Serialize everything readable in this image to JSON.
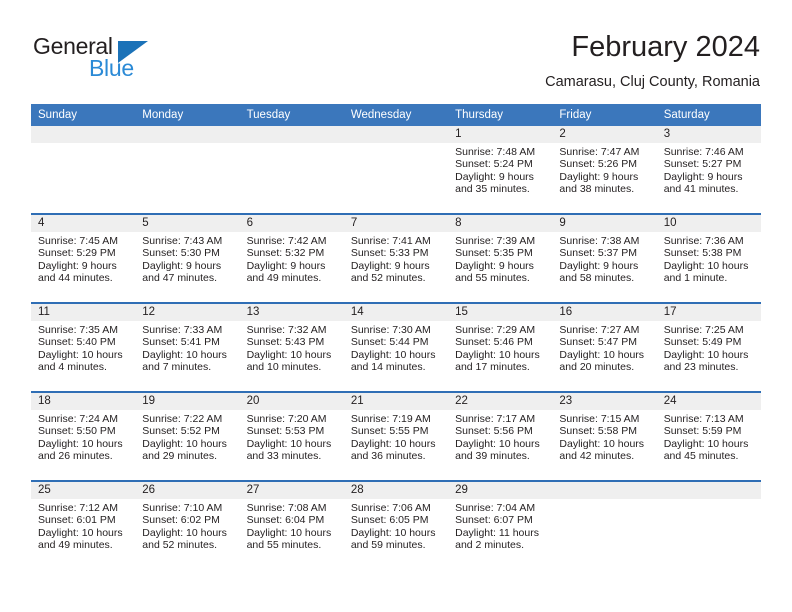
{
  "brand": {
    "line1": "General",
    "line2": "Blue",
    "triangle_color": "#1b72b8",
    "blue_text_color": "#2b8ad6"
  },
  "header": {
    "title": "February 2024",
    "location": "Camarasu, Cluj County, Romania"
  },
  "theme": {
    "header_blue": "#3b77bc",
    "row_divider_blue": "#2f6eb5",
    "daynum_band_gray": "#efefef",
    "text": "#231f20"
  },
  "weekday_headers": [
    "Sunday",
    "Monday",
    "Tuesday",
    "Wednesday",
    "Thursday",
    "Friday",
    "Saturday"
  ],
  "weeks": [
    [
      {
        "day": "",
        "sunrise": "",
        "sunset": "",
        "daylight": "",
        "empty": true
      },
      {
        "day": "",
        "sunrise": "",
        "sunset": "",
        "daylight": "",
        "empty": true
      },
      {
        "day": "",
        "sunrise": "",
        "sunset": "",
        "daylight": "",
        "empty": true
      },
      {
        "day": "",
        "sunrise": "",
        "sunset": "",
        "daylight": "",
        "empty": true
      },
      {
        "day": "1",
        "sunrise": "Sunrise: 7:48 AM",
        "sunset": "Sunset: 5:24 PM",
        "daylight": "Daylight: 9 hours and 35 minutes.",
        "empty": false
      },
      {
        "day": "2",
        "sunrise": "Sunrise: 7:47 AM",
        "sunset": "Sunset: 5:26 PM",
        "daylight": "Daylight: 9 hours and 38 minutes.",
        "empty": false
      },
      {
        "day": "3",
        "sunrise": "Sunrise: 7:46 AM",
        "sunset": "Sunset: 5:27 PM",
        "daylight": "Daylight: 9 hours and 41 minutes.",
        "empty": false
      }
    ],
    [
      {
        "day": "4",
        "sunrise": "Sunrise: 7:45 AM",
        "sunset": "Sunset: 5:29 PM",
        "daylight": "Daylight: 9 hours and 44 minutes.",
        "empty": false
      },
      {
        "day": "5",
        "sunrise": "Sunrise: 7:43 AM",
        "sunset": "Sunset: 5:30 PM",
        "daylight": "Daylight: 9 hours and 47 minutes.",
        "empty": false
      },
      {
        "day": "6",
        "sunrise": "Sunrise: 7:42 AM",
        "sunset": "Sunset: 5:32 PM",
        "daylight": "Daylight: 9 hours and 49 minutes.",
        "empty": false
      },
      {
        "day": "7",
        "sunrise": "Sunrise: 7:41 AM",
        "sunset": "Sunset: 5:33 PM",
        "daylight": "Daylight: 9 hours and 52 minutes.",
        "empty": false
      },
      {
        "day": "8",
        "sunrise": "Sunrise: 7:39 AM",
        "sunset": "Sunset: 5:35 PM",
        "daylight": "Daylight: 9 hours and 55 minutes.",
        "empty": false
      },
      {
        "day": "9",
        "sunrise": "Sunrise: 7:38 AM",
        "sunset": "Sunset: 5:37 PM",
        "daylight": "Daylight: 9 hours and 58 minutes.",
        "empty": false
      },
      {
        "day": "10",
        "sunrise": "Sunrise: 7:36 AM",
        "sunset": "Sunset: 5:38 PM",
        "daylight": "Daylight: 10 hours and 1 minute.",
        "empty": false
      }
    ],
    [
      {
        "day": "11",
        "sunrise": "Sunrise: 7:35 AM",
        "sunset": "Sunset: 5:40 PM",
        "daylight": "Daylight: 10 hours and 4 minutes.",
        "empty": false
      },
      {
        "day": "12",
        "sunrise": "Sunrise: 7:33 AM",
        "sunset": "Sunset: 5:41 PM",
        "daylight": "Daylight: 10 hours and 7 minutes.",
        "empty": false
      },
      {
        "day": "13",
        "sunrise": "Sunrise: 7:32 AM",
        "sunset": "Sunset: 5:43 PM",
        "daylight": "Daylight: 10 hours and 10 minutes.",
        "empty": false
      },
      {
        "day": "14",
        "sunrise": "Sunrise: 7:30 AM",
        "sunset": "Sunset: 5:44 PM",
        "daylight": "Daylight: 10 hours and 14 minutes.",
        "empty": false
      },
      {
        "day": "15",
        "sunrise": "Sunrise: 7:29 AM",
        "sunset": "Sunset: 5:46 PM",
        "daylight": "Daylight: 10 hours and 17 minutes.",
        "empty": false
      },
      {
        "day": "16",
        "sunrise": "Sunrise: 7:27 AM",
        "sunset": "Sunset: 5:47 PM",
        "daylight": "Daylight: 10 hours and 20 minutes.",
        "empty": false
      },
      {
        "day": "17",
        "sunrise": "Sunrise: 7:25 AM",
        "sunset": "Sunset: 5:49 PM",
        "daylight": "Daylight: 10 hours and 23 minutes.",
        "empty": false
      }
    ],
    [
      {
        "day": "18",
        "sunrise": "Sunrise: 7:24 AM",
        "sunset": "Sunset: 5:50 PM",
        "daylight": "Daylight: 10 hours and 26 minutes.",
        "empty": false
      },
      {
        "day": "19",
        "sunrise": "Sunrise: 7:22 AM",
        "sunset": "Sunset: 5:52 PM",
        "daylight": "Daylight: 10 hours and 29 minutes.",
        "empty": false
      },
      {
        "day": "20",
        "sunrise": "Sunrise: 7:20 AM",
        "sunset": "Sunset: 5:53 PM",
        "daylight": "Daylight: 10 hours and 33 minutes.",
        "empty": false
      },
      {
        "day": "21",
        "sunrise": "Sunrise: 7:19 AM",
        "sunset": "Sunset: 5:55 PM",
        "daylight": "Daylight: 10 hours and 36 minutes.",
        "empty": false
      },
      {
        "day": "22",
        "sunrise": "Sunrise: 7:17 AM",
        "sunset": "Sunset: 5:56 PM",
        "daylight": "Daylight: 10 hours and 39 minutes.",
        "empty": false
      },
      {
        "day": "23",
        "sunrise": "Sunrise: 7:15 AM",
        "sunset": "Sunset: 5:58 PM",
        "daylight": "Daylight: 10 hours and 42 minutes.",
        "empty": false
      },
      {
        "day": "24",
        "sunrise": "Sunrise: 7:13 AM",
        "sunset": "Sunset: 5:59 PM",
        "daylight": "Daylight: 10 hours and 45 minutes.",
        "empty": false
      }
    ],
    [
      {
        "day": "25",
        "sunrise": "Sunrise: 7:12 AM",
        "sunset": "Sunset: 6:01 PM",
        "daylight": "Daylight: 10 hours and 49 minutes.",
        "empty": false
      },
      {
        "day": "26",
        "sunrise": "Sunrise: 7:10 AM",
        "sunset": "Sunset: 6:02 PM",
        "daylight": "Daylight: 10 hours and 52 minutes.",
        "empty": false
      },
      {
        "day": "27",
        "sunrise": "Sunrise: 7:08 AM",
        "sunset": "Sunset: 6:04 PM",
        "daylight": "Daylight: 10 hours and 55 minutes.",
        "empty": false
      },
      {
        "day": "28",
        "sunrise": "Sunrise: 7:06 AM",
        "sunset": "Sunset: 6:05 PM",
        "daylight": "Daylight: 10 hours and 59 minutes.",
        "empty": false
      },
      {
        "day": "29",
        "sunrise": "Sunrise: 7:04 AM",
        "sunset": "Sunset: 6:07 PM",
        "daylight": "Daylight: 11 hours and 2 minutes.",
        "empty": false
      },
      {
        "day": "",
        "sunrise": "",
        "sunset": "",
        "daylight": "",
        "empty": true
      },
      {
        "day": "",
        "sunrise": "",
        "sunset": "",
        "daylight": "",
        "empty": true
      }
    ]
  ]
}
